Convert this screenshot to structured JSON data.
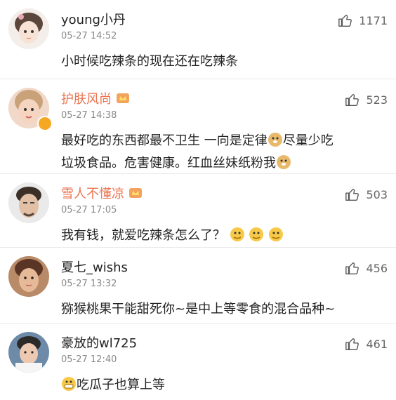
{
  "comments": [
    {
      "user": "young小丹",
      "time": "05-27 14:52",
      "likes": "1171",
      "text": "小时候吃辣条的现在还在吃辣条"
    },
    {
      "user": "护肤风尚",
      "time": "05-27 14:38",
      "likes": "523",
      "text_a": "最好吃的东西都最不卫生 一向是定律",
      "text_b": "尽量少吃",
      "text_c": "垃圾食品。危害健康。红血丝妹纸粉我"
    },
    {
      "user": "雪人不懂凉",
      "time": "05-27 17:05",
      "likes": "503",
      "text": "我有钱，就爱吃辣条怎么了？"
    },
    {
      "user": "夏七_wishs",
      "time": "05-27 13:32",
      "likes": "456",
      "text": "猕猴桃果干能甜死你~是中上等零食的混合品种~"
    },
    {
      "user": "豪放的wl725",
      "time": "05-27 12:40",
      "likes": "461",
      "text": "吃瓜子也算上等"
    }
  ],
  "colors": {
    "vip_name": "#eb7350",
    "text": "#222222",
    "meta": "#8a8a8a"
  },
  "icons": {
    "like": "thumbs-up-icon",
    "vip_badge": "crown-icon"
  }
}
